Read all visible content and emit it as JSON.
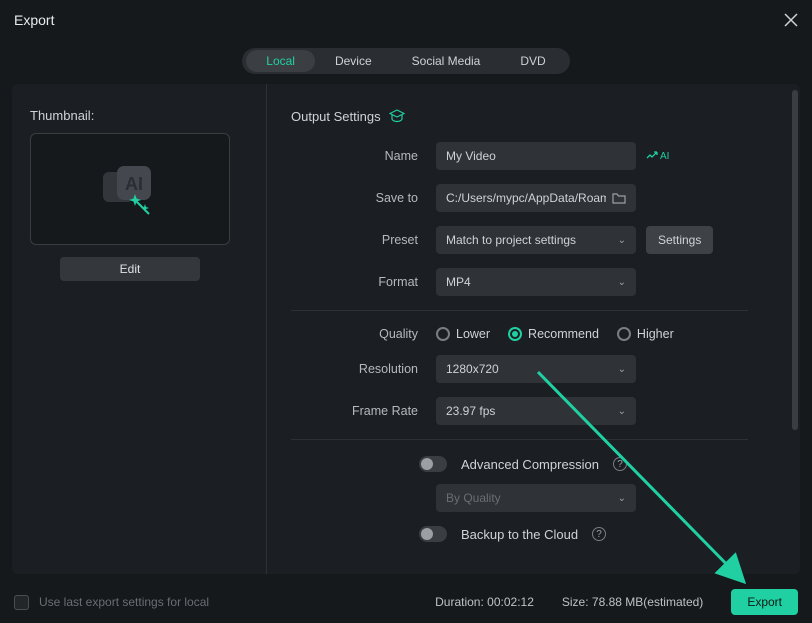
{
  "window": {
    "title": "Export"
  },
  "tabs": {
    "local": "Local",
    "device": "Device",
    "social": "Social Media",
    "dvd": "DVD"
  },
  "thumbnail": {
    "label": "Thumbnail:",
    "edit": "Edit"
  },
  "output": {
    "section_label": "Output Settings",
    "name_label": "Name",
    "name_value": "My Video",
    "ai_label": "AI",
    "saveto_label": "Save to",
    "saveto_value": "C:/Users/mypc/AppData/Roaming",
    "preset_label": "Preset",
    "preset_value": "Match to project settings",
    "settings_btn": "Settings",
    "format_label": "Format",
    "format_value": "MP4",
    "quality_label": "Quality",
    "quality_lower": "Lower",
    "quality_recommend": "Recommend",
    "quality_higher": "Higher",
    "resolution_label": "Resolution",
    "resolution_value": "1280x720",
    "framerate_label": "Frame Rate",
    "framerate_value": "23.97 fps",
    "adv_compression": "Advanced Compression",
    "by_quality": "By Quality",
    "backup_cloud": "Backup to the Cloud"
  },
  "footer": {
    "use_last": "Use last export settings for local",
    "duration_label": "Duration:",
    "duration_value": "00:02:12",
    "size_label": "Size:",
    "size_value": "78.88 MB(estimated)",
    "export_btn": "Export"
  },
  "colors": {
    "accent": "#21d0a2"
  }
}
